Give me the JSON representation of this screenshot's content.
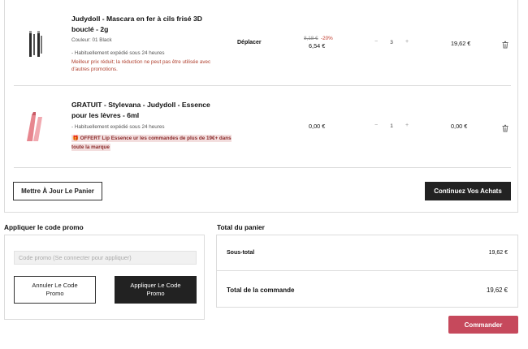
{
  "cart": {
    "items": [
      {
        "name": "Judydoll - Mascara en fer à cils frisé 3D bouclé - 2g",
        "variant": "Couleur: 01 Black",
        "shipping": "- Habituellement expédié sous 24 heures",
        "note": "Meilleur prix réduit; la réduction ne peut pas être utilisée avec d'autres promotions.",
        "move_label": "Déplacer",
        "old_price": "8,18 €",
        "discount": "-20%",
        "price": "6,54 €",
        "quantity": "3",
        "total": "19,62 €",
        "image_icon": "mascara-product-image"
      },
      {
        "name": "GRATUIT - Stylevana - Judydoll - Essence pour les lèvres - 6ml",
        "shipping": "- Habituellement expédié sous 24 heures",
        "gift_note": "🎁 OFFERT Lip Essence ur les commandes de plus de 19€+ dans toute la marque",
        "price": "0,00 €",
        "quantity": "1",
        "total": "0,00 €",
        "image_icon": "lip-essence-product-image"
      }
    ],
    "qty_minus": "−",
    "qty_plus": "+",
    "update_label": "Mettre À Jour Le Panier",
    "continue_label": "Continuez Vos Achats"
  },
  "promo": {
    "title": "Appliquer le code promo",
    "placeholder": "Code promo (Se connecter pour appliquer)",
    "cancel_label": "Annuler Le Code Promo",
    "apply_label": "Appliquer Le Code Promo"
  },
  "totals": {
    "title": "Total du panier",
    "subtotal_label": "Sous-total",
    "subtotal_value": "19,62 €",
    "grand_label": "Total de la commande",
    "grand_value": "19,62 €"
  },
  "checkout_label": "Commander",
  "colors": {
    "accent": "#c6495c",
    "dark_button": "#222222",
    "note_text": "#b0402f",
    "product_pink": "#e7868f"
  }
}
